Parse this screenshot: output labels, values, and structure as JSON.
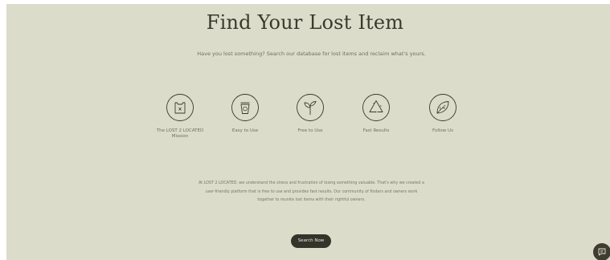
{
  "hero": {
    "title": "Find Your Lost Item",
    "subtitle": "Have you lost something? Search our database for lost items and reclaim what's yours."
  },
  "features": [
    {
      "label": "The LOST 2 LOCATED Mission",
      "icon": "bag-icon"
    },
    {
      "label": "Easy to Use",
      "icon": "cup-icon"
    },
    {
      "label": "Free to Use",
      "icon": "sprout-icon"
    },
    {
      "label": "Fast Results",
      "icon": "recycle-icon"
    },
    {
      "label": "Follow Us",
      "icon": "leaf-icon"
    }
  ],
  "description": "At LOST 2 LOCATED, we understand the stress and frustration of losing something valuable. That's why we created a user-friendly platform that is free to use and provides fast results. Our community of finders and owners work together to reunite lost items with their rightful owners.",
  "cta": {
    "label": "Search Now"
  },
  "chat": {
    "icon": "chat-icon"
  },
  "colors": {
    "background": "#dcdccb",
    "text_dark": "#3a3a2c",
    "button": "#34342a"
  }
}
